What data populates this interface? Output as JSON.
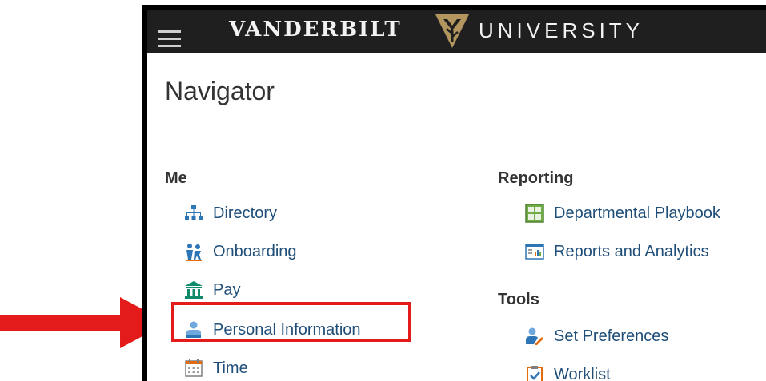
{
  "header": {
    "logo_left": "VANDERBILT",
    "logo_right": "UNIVERSITY"
  },
  "page": {
    "title": "Navigator"
  },
  "sections": {
    "me": {
      "heading": "Me",
      "items": [
        {
          "label": "Directory",
          "icon": "org-chart-icon"
        },
        {
          "label": "Onboarding",
          "icon": "onboarding-icon"
        },
        {
          "label": "Pay",
          "icon": "bank-icon"
        },
        {
          "label": "Personal Information",
          "icon": "person-icon"
        },
        {
          "label": "Time",
          "icon": "calendar-icon"
        }
      ]
    },
    "reporting": {
      "heading": "Reporting",
      "items": [
        {
          "label": "Departmental Playbook",
          "icon": "spreadsheet-icon"
        },
        {
          "label": "Reports and Analytics",
          "icon": "bar-chart-icon"
        }
      ]
    },
    "tools": {
      "heading": "Tools",
      "items": [
        {
          "label": "Set Preferences",
          "icon": "user-edit-icon"
        },
        {
          "label": "Worklist",
          "icon": "clipboard-check-icon"
        }
      ]
    }
  },
  "colors": {
    "header_bg": "#1f1f1f",
    "vanderbilt_gold": "#b3955f",
    "link": "#1f4e79",
    "highlight": "#e31b1b"
  }
}
